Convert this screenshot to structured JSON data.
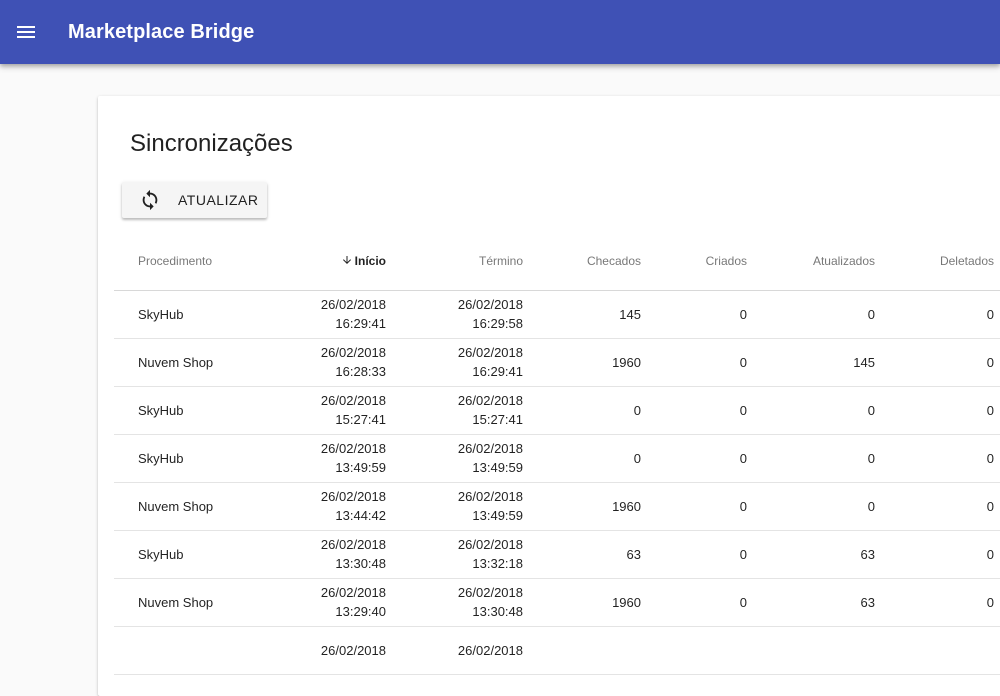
{
  "app": {
    "title": "Marketplace Bridge",
    "menu_icon": "menu-icon",
    "primary_color": "#3f51b5"
  },
  "page": {
    "title": "Sincronizações",
    "refresh_button": {
      "label": "ATUALIZAR",
      "icon": "refresh-icon"
    }
  },
  "table": {
    "columns": [
      "Procedimento",
      "Início",
      "Término",
      "Checados",
      "Criados",
      "Atualizados",
      "Deletados"
    ],
    "sorted_column": "Início",
    "sort_direction": "desc",
    "rows": [
      {
        "procedimento": "SkyHub",
        "inicio_date": "26/02/2018",
        "inicio_time": "16:29:41",
        "termino_date": "26/02/2018",
        "termino_time": "16:29:58",
        "checados": "145",
        "criados": "0",
        "atualizados": "0",
        "deletados": "0"
      },
      {
        "procedimento": "Nuvem Shop",
        "inicio_date": "26/02/2018",
        "inicio_time": "16:28:33",
        "termino_date": "26/02/2018",
        "termino_time": "16:29:41",
        "checados": "1960",
        "criados": "0",
        "atualizados": "145",
        "deletados": "0"
      },
      {
        "procedimento": "SkyHub",
        "inicio_date": "26/02/2018",
        "inicio_time": "15:27:41",
        "termino_date": "26/02/2018",
        "termino_time": "15:27:41",
        "checados": "0",
        "criados": "0",
        "atualizados": "0",
        "deletados": "0"
      },
      {
        "procedimento": "SkyHub",
        "inicio_date": "26/02/2018",
        "inicio_time": "13:49:59",
        "termino_date": "26/02/2018",
        "termino_time": "13:49:59",
        "checados": "0",
        "criados": "0",
        "atualizados": "0",
        "deletados": "0"
      },
      {
        "procedimento": "Nuvem Shop",
        "inicio_date": "26/02/2018",
        "inicio_time": "13:44:42",
        "termino_date": "26/02/2018",
        "termino_time": "13:49:59",
        "checados": "1960",
        "criados": "0",
        "atualizados": "0",
        "deletados": "0"
      },
      {
        "procedimento": "SkyHub",
        "inicio_date": "26/02/2018",
        "inicio_time": "13:30:48",
        "termino_date": "26/02/2018",
        "termino_time": "13:32:18",
        "checados": "63",
        "criados": "0",
        "atualizados": "63",
        "deletados": "0"
      },
      {
        "procedimento": "Nuvem Shop",
        "inicio_date": "26/02/2018",
        "inicio_time": "13:29:40",
        "termino_date": "26/02/2018",
        "termino_time": "13:30:48",
        "checados": "1960",
        "criados": "0",
        "atualizados": "63",
        "deletados": "0"
      },
      {
        "procedimento": "",
        "inicio_date": "26/02/2018",
        "inicio_time": "",
        "termino_date": "26/02/2018",
        "termino_time": "",
        "checados": "",
        "criados": "",
        "atualizados": "",
        "deletados": ""
      }
    ]
  }
}
